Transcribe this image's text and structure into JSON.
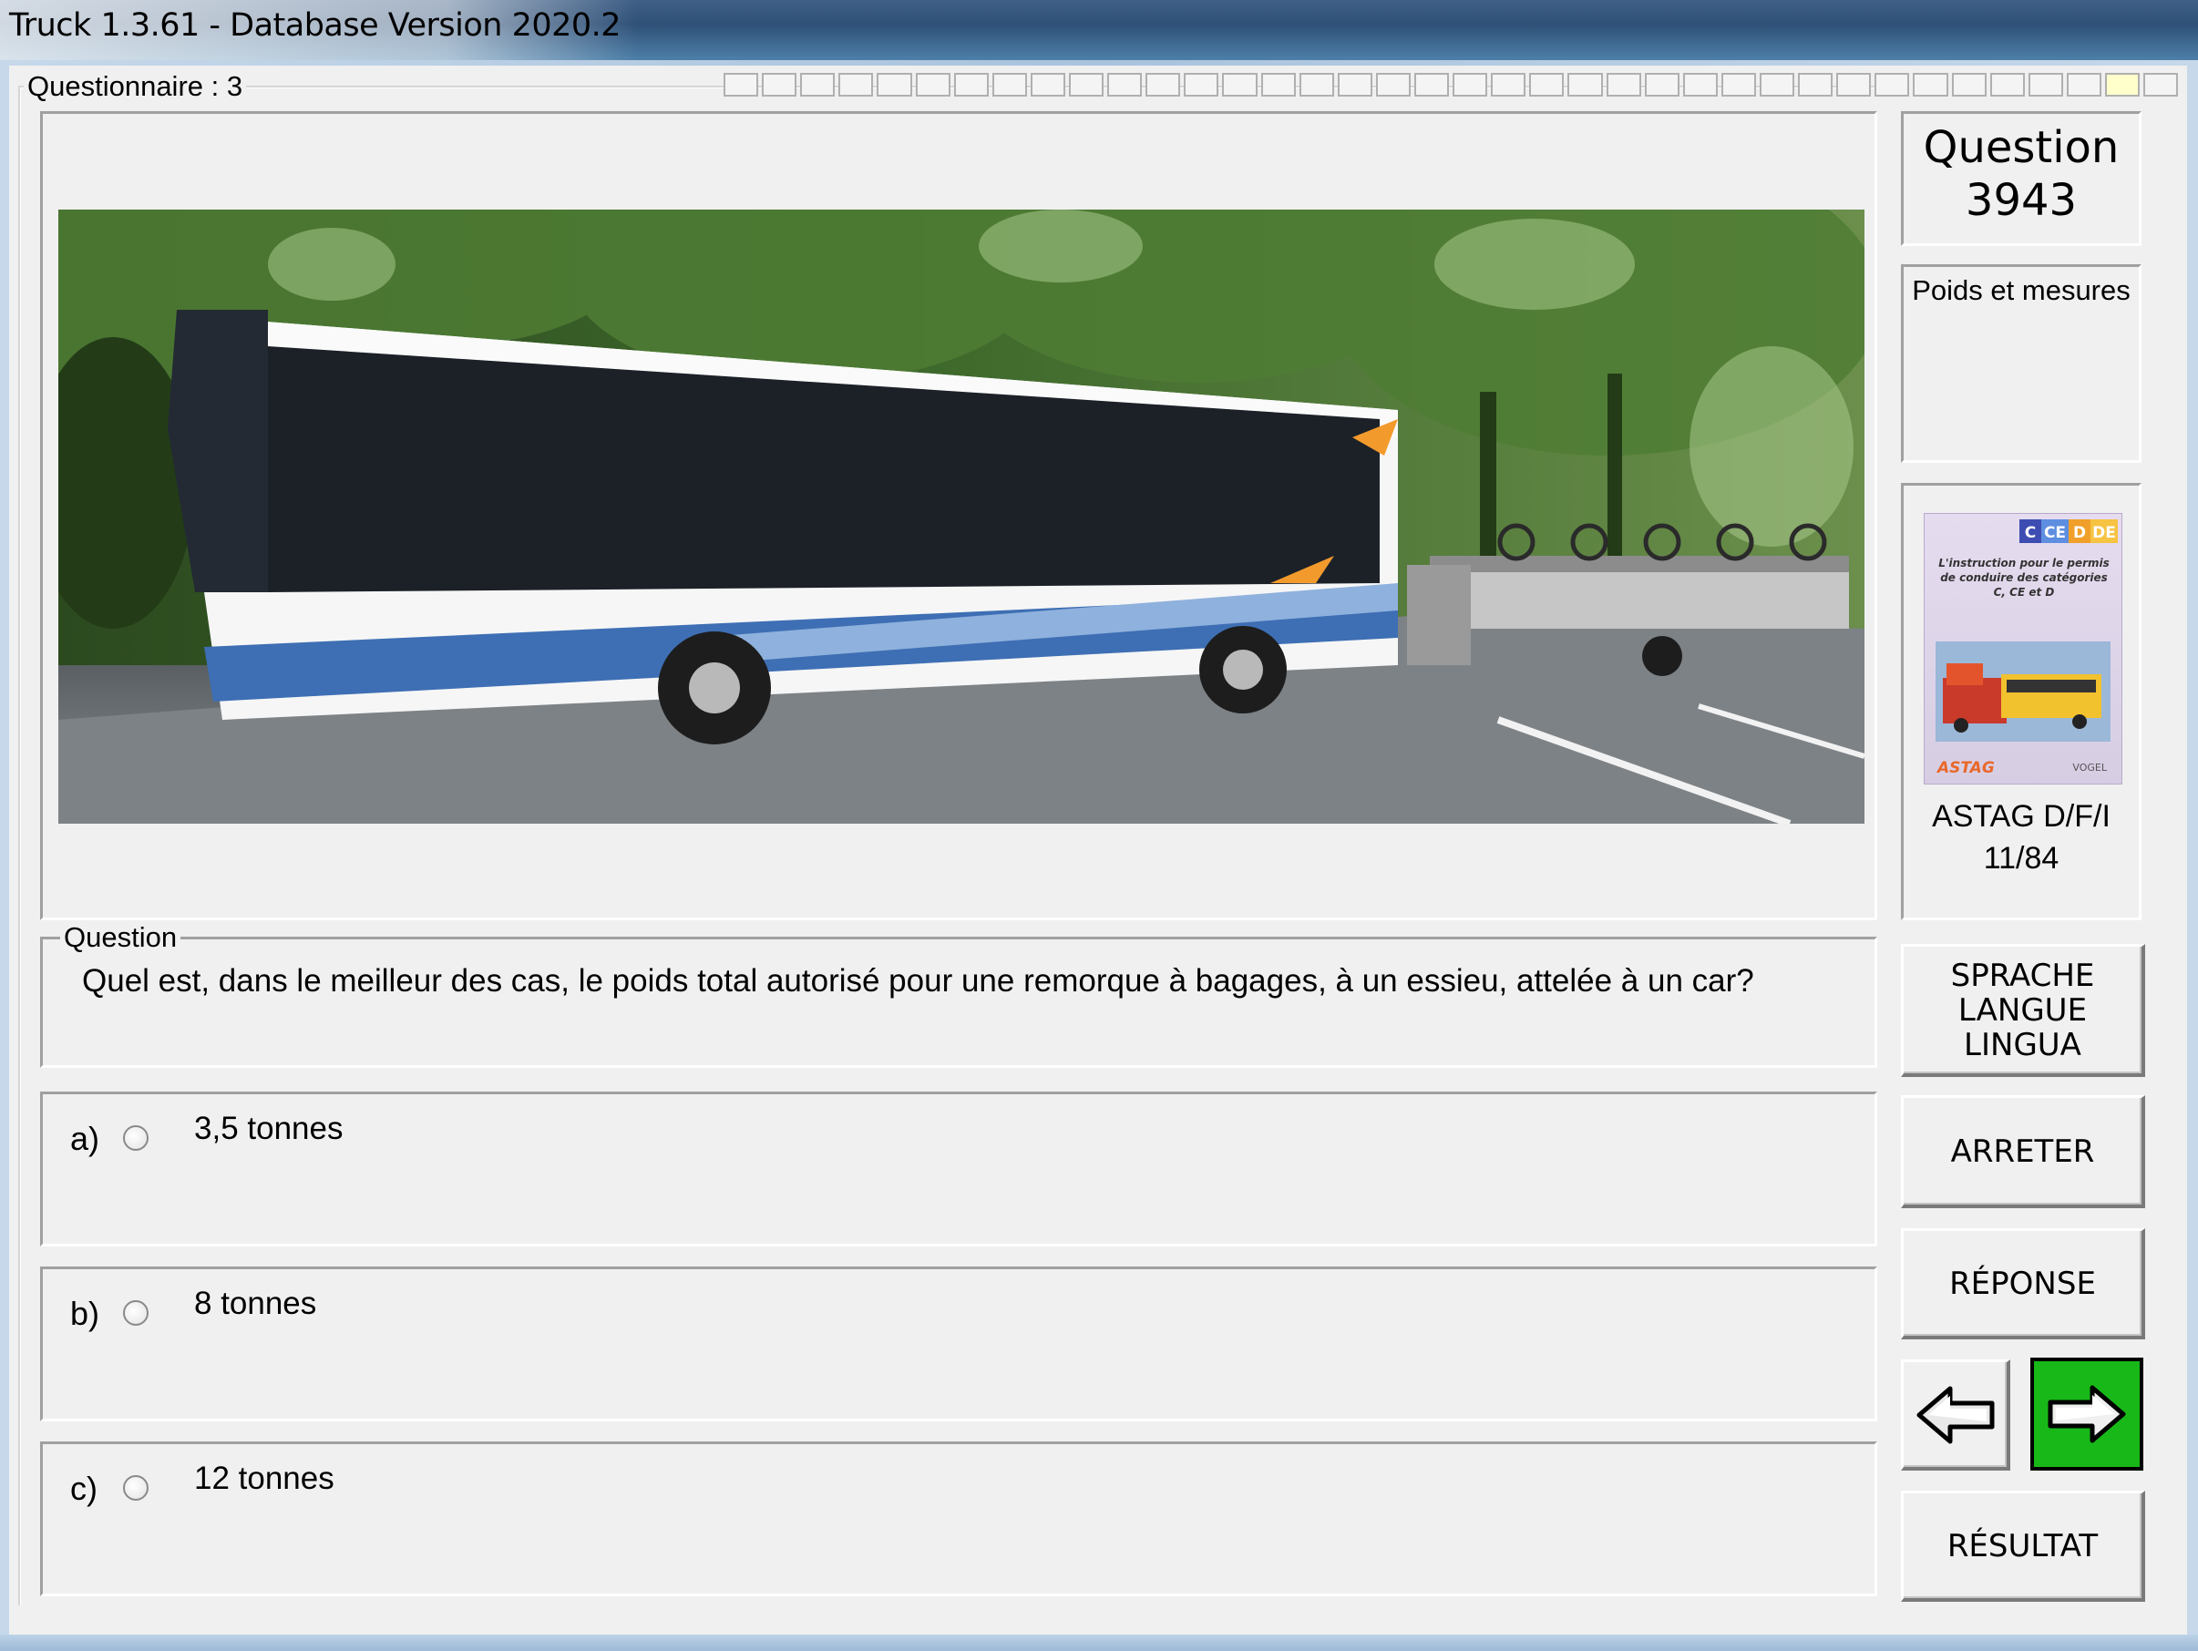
{
  "window": {
    "title": "Truck 1.3.61 - Database Version 2020.2"
  },
  "questionnaire": {
    "label": "Questionnaire : 3"
  },
  "question_panel": {
    "legend": "Question",
    "text": "Quel est, dans le meilleur des cas, le poids total autorisé pour une remorque à bagages, à un essieu, attelée à un car?"
  },
  "answers": [
    {
      "letter": "a)",
      "text": "3,5 tonnes"
    },
    {
      "letter": "b)",
      "text": "8 tonnes"
    },
    {
      "letter": "c)",
      "text": "12 tonnes"
    }
  ],
  "sidebar": {
    "question_label": "Question",
    "question_number": "3943",
    "category": "Poids et mesures",
    "book_reference_line1": "ASTAG D/F/I",
    "book_reference_line2": "11/84",
    "book_badges": [
      "C",
      "CE",
      "D",
      "DE"
    ],
    "book_title": "L'instruction pour le permis de conduire des catégories C, CE et D",
    "book_publisher_left": "ASTAG",
    "book_publisher_right": "VOGEL"
  },
  "buttons": {
    "langue_line1": "SPRACHE",
    "langue_line2": "LANGUE",
    "langue_line3": "LINGUA",
    "arreter": "ARRETER",
    "reponse": "RÉPONSE",
    "resultat": "RÉSULTAT"
  },
  "colors": {
    "next_button_bg": "#18b818",
    "window_bg": "#f0f0f0",
    "titlebar": "#2f5077"
  },
  "icons": {
    "prev": "arrow-left-icon",
    "next": "arrow-right-icon"
  }
}
